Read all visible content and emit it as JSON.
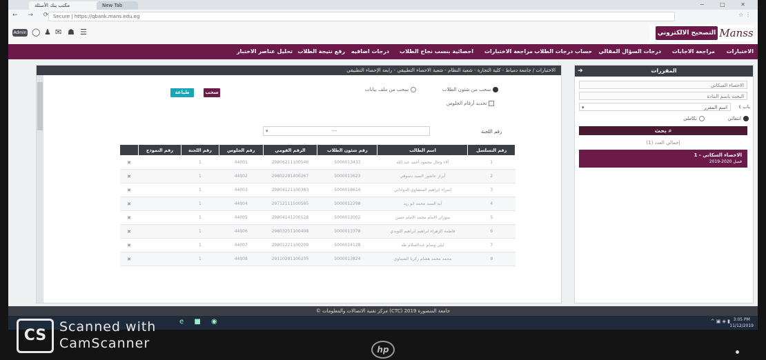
{
  "browser": {
    "tab_active": "مكتب بنك الأسئلة",
    "tab_inactive": "New Tab",
    "url": "Secure | https://qbank.mans.edu.eg"
  },
  "header": {
    "brand_title": "التصحيح الالكتروني",
    "brand_logo": "Manss",
    "pill": "Admin"
  },
  "main_nav": [
    "الاختبارات",
    "مراجعة الاجابات",
    "درجات السؤال المقالي",
    "حساب درجات الطلاب",
    "مراجعة الاختبارات",
    "احصائية بنسب نجاح الطلاب",
    "درجات اضافيه",
    "رفع نتيجة الطلاب",
    "تحليل عناصر الاختبار"
  ],
  "sidebar": {
    "title": "المقررات",
    "input1": "الاحصاء السكاني",
    "input2": "البحث باسم المادة",
    "select_label": "باب ٤",
    "select_value": "اسم المقرر",
    "radio_current": "انتقائي",
    "radio_other": "تكاملي",
    "search_button": "بحث",
    "count": "إجمالي العدد (1)",
    "result_title": "1 - الاحصاء السكاني",
    "result_sub": "2019-2020 فصل"
  },
  "content": {
    "breadcrumb": "الاختبارات / جامعة دمياط - كلية التجارة - شعبة النظام - شعبة الاحصاء التطبيقي - رابعة الإحصاء التطبيقي",
    "withdraw_button": "سحب",
    "print_button": "طباعة",
    "opt_affairs": "سحب من شئون الطلاب",
    "opt_file": "سحب من ملف بيانات",
    "opt_seat": "تحديد أرقام الجلوس",
    "committee_label": "رقم اللجنة",
    "committee_placeholder": "---"
  },
  "table": {
    "headers": [
      "رقم التسلسل",
      "اسم الطالب",
      "رقم شئون الطلاب",
      "الرقم القومي",
      "رقم الجلوس",
      "رقم اللجنة",
      "رقم النموذج",
      ""
    ],
    "rows": [
      [
        "1",
        "آلاء وجال محمود أحمد عبد الله",
        "5000013433",
        "29806211100546",
        "44001",
        "1",
        "",
        "✖"
      ],
      [
        "2",
        "أبرار عاشور السيد دسوقي",
        "5000013623",
        "29802281400267",
        "44002",
        "1",
        "",
        "✖"
      ],
      [
        "3",
        "اسراء ابراهيم المنشاوي الدواداني",
        "5000018614",
        "29804121100383",
        "44003",
        "1",
        "",
        "✖"
      ],
      [
        "4",
        "آيه السيد محمد ابو زيد",
        "5000012298",
        "29712111500585",
        "44004",
        "1",
        "",
        "✖"
      ],
      [
        "5",
        "سوزان الامام محمد الامام حسن",
        "5000013002",
        "29804141200128",
        "44005",
        "1",
        "",
        "✖"
      ],
      [
        "6",
        "فاطمة الزهراء ابراهيم ابراهيم الثوبدي",
        "5000013378",
        "29803251100408",
        "44006",
        "1",
        "",
        "✖"
      ],
      [
        "7",
        "ليلى وسام عبدالسلام طه",
        "5000014128",
        "29801221100209",
        "44007",
        "1",
        "",
        "✖"
      ],
      [
        "8",
        "محمد محمد هشام زكريا الشيناوي",
        "5000013824",
        "29110281100235",
        "44008",
        "1",
        "",
        "✖"
      ]
    ]
  },
  "footer": "© مركز تقنية الاتصالات والمعلومات (CTC) جامعة المنصورة 2019",
  "taskbar": {
    "time": "3:05 PM",
    "date": "11/12/2019"
  },
  "overlay": {
    "cs": "CS",
    "line1": "Scanned with",
    "line2": "CamScanner",
    "hp": "hp"
  }
}
